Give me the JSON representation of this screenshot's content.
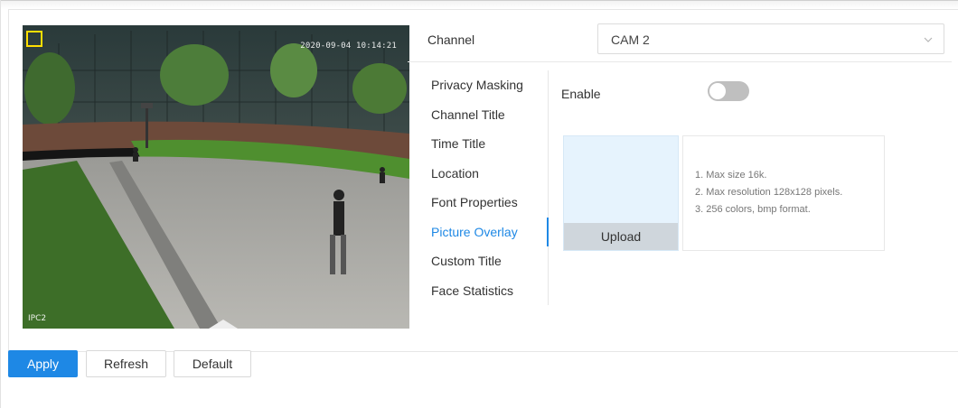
{
  "video": {
    "timestamp": "2020-09-04 10:14:21",
    "channel_overlay": "IPC2"
  },
  "channel": {
    "label": "Channel",
    "selected": "CAM 2"
  },
  "menu": {
    "items": [
      {
        "label": "Privacy Masking",
        "active": false
      },
      {
        "label": "Channel Title",
        "active": false
      },
      {
        "label": "Time Title",
        "active": false
      },
      {
        "label": "Location",
        "active": false
      },
      {
        "label": "Font Properties",
        "active": false
      },
      {
        "label": "Picture Overlay",
        "active": true
      },
      {
        "label": "Custom Title",
        "active": false
      },
      {
        "label": "Face Statistics",
        "active": false
      }
    ]
  },
  "picture_overlay": {
    "enable_label": "Enable",
    "enabled": false,
    "upload_label": "Upload",
    "hints": [
      "1. Max size 16k.",
      "2. Max resolution 128x128 pixels.",
      "3. 256 colors, bmp format."
    ]
  },
  "actions": {
    "apply": "Apply",
    "refresh": "Refresh",
    "default": "Default"
  },
  "colors": {
    "accent": "#1e88e5",
    "toggle_off": "#bfbfbf",
    "upload_bg": "#e6f3fd",
    "overlay_box": "#ffde00"
  }
}
